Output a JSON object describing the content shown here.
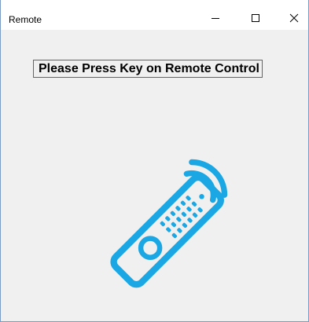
{
  "window": {
    "title": "Remote",
    "controls": {
      "minimize": "minimize-icon",
      "maximize": "maximize-icon",
      "close": "close-icon"
    }
  },
  "content": {
    "prompt": "Please Press Key on Remote Control",
    "icon": "remote-control-icon",
    "icon_color": "#1aa7e4"
  }
}
